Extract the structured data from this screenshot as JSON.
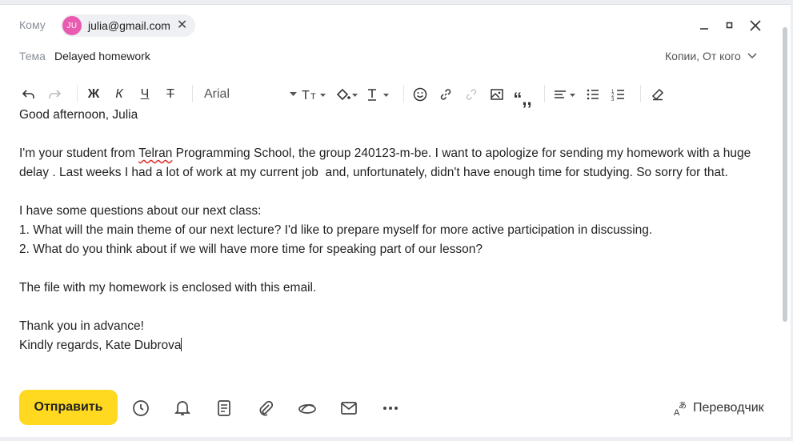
{
  "to": {
    "label": "Кому",
    "recipient_initials": "JU",
    "recipient_email": "julia@gmail.com"
  },
  "subject": {
    "label": "Тема",
    "value": "Delayed homework",
    "cc_link": "Копии, От кого"
  },
  "toolbar": {
    "font": "Arial"
  },
  "body": {
    "greeting": "Good afternoon, Julia",
    "p1_before": "I'm your student from ",
    "p1_misspelled": "Telran",
    "p1_after": " Programming School, the group 240123-m-be. I want to apologize for sending my homework with a huge delay . Last weeks I had a lot of work at my current job  and, unfortunately, didn't have enough time for studying. So sorry for that.",
    "questions_intro": "I have some questions about our next class:",
    "question1": "1. What will the main theme of our next lecture? I'd like to prepare myself for more active participation in discussing.",
    "question2": "2. What do you think about if we will have more time for speaking part of our lesson?",
    "attachment_note": "The file with my homework is enclosed with this email.",
    "thanks": "Thank you in advance!",
    "signature": "Kindly regards, Kate Dubrova"
  },
  "footer": {
    "send_label": "Отправить",
    "translator_label": "Переводчик"
  },
  "colors": {
    "send_bg": "#ffd820",
    "avatar_bg": "#e95bb1",
    "chip_bg": "#eef0f3",
    "spell_underline": "#e0322f"
  },
  "icons": {
    "toolbar": [
      "undo-icon",
      "redo-icon",
      "bold-icon",
      "italic-icon",
      "underline-icon",
      "strikethrough-icon",
      "text-size-icon",
      "fill-color-icon",
      "text-color-icon",
      "emoji-icon",
      "link-icon",
      "unlink-icon",
      "image-icon",
      "quote-icon",
      "align-icon",
      "bullet-list-icon",
      "numbered-list-icon",
      "clear-format-icon"
    ],
    "footer": [
      "clock-icon",
      "bell-icon",
      "template-icon",
      "attach-icon",
      "disk-icon",
      "envelope-icon",
      "more-icon",
      "translate-icon"
    ]
  }
}
